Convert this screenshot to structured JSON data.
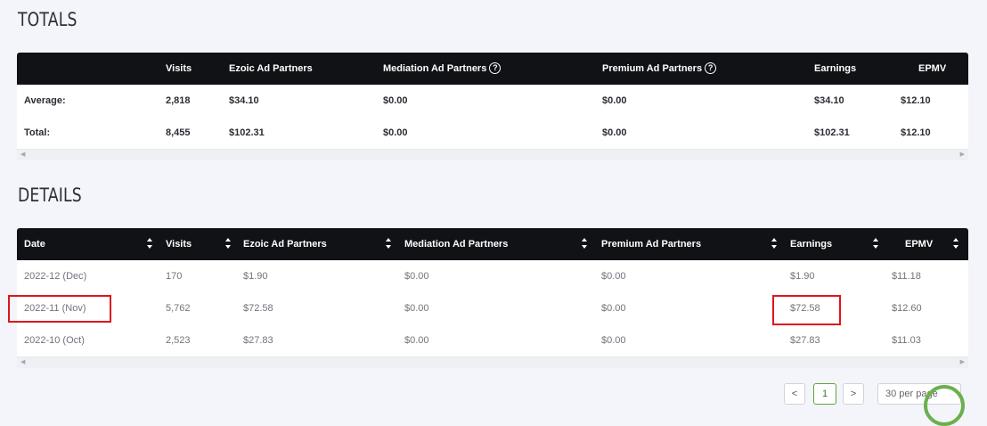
{
  "totals": {
    "title": "TOTALS",
    "headers": [
      "",
      "Visits",
      "Ezoic Ad Partners",
      "Mediation Ad Partners",
      "Premium Ad Partners",
      "Earnings",
      "EPMV"
    ],
    "rows": [
      {
        "label": "Average:",
        "visits": "2,818",
        "ezoic": "$34.10",
        "mediation": "$0.00",
        "premium": "$0.00",
        "earnings": "$34.10",
        "epmv": "$12.10"
      },
      {
        "label": "Total:",
        "visits": "8,455",
        "ezoic": "$102.31",
        "mediation": "$0.00",
        "premium": "$0.00",
        "earnings": "$102.31",
        "epmv": "$12.10"
      }
    ]
  },
  "details": {
    "title": "DETAILS",
    "headers": [
      "Date",
      "Visits",
      "Ezoic Ad Partners",
      "Mediation Ad Partners",
      "Premium Ad Partners",
      "Earnings",
      "EPMV"
    ],
    "rows": [
      {
        "date": "2022-12 (Dec)",
        "visits": "170",
        "ezoic": "$1.90",
        "mediation": "$0.00",
        "premium": "$0.00",
        "earnings": "$1.90",
        "epmv": "$11.18"
      },
      {
        "date": "2022-11 (Nov)",
        "visits": "5,762",
        "ezoic": "$72.58",
        "mediation": "$0.00",
        "premium": "$0.00",
        "earnings": "$72.58",
        "epmv": "$12.60"
      },
      {
        "date": "2022-10 (Oct)",
        "visits": "2,523",
        "ezoic": "$27.83",
        "mediation": "$0.00",
        "premium": "$0.00",
        "earnings": "$27.83",
        "epmv": "$11.03"
      }
    ]
  },
  "pagination": {
    "prev": "<",
    "page": "1",
    "next": ">",
    "per_page": "30 per page"
  },
  "icons": {
    "help": "question-circle-icon",
    "sort": "sort-icon",
    "scroll_left": "arrow-left-icon",
    "scroll_right": "arrow-right-icon"
  },
  "colors": {
    "header_bg": "#111216",
    "highlight": "#e0141c",
    "accent": "#6ab04c"
  }
}
